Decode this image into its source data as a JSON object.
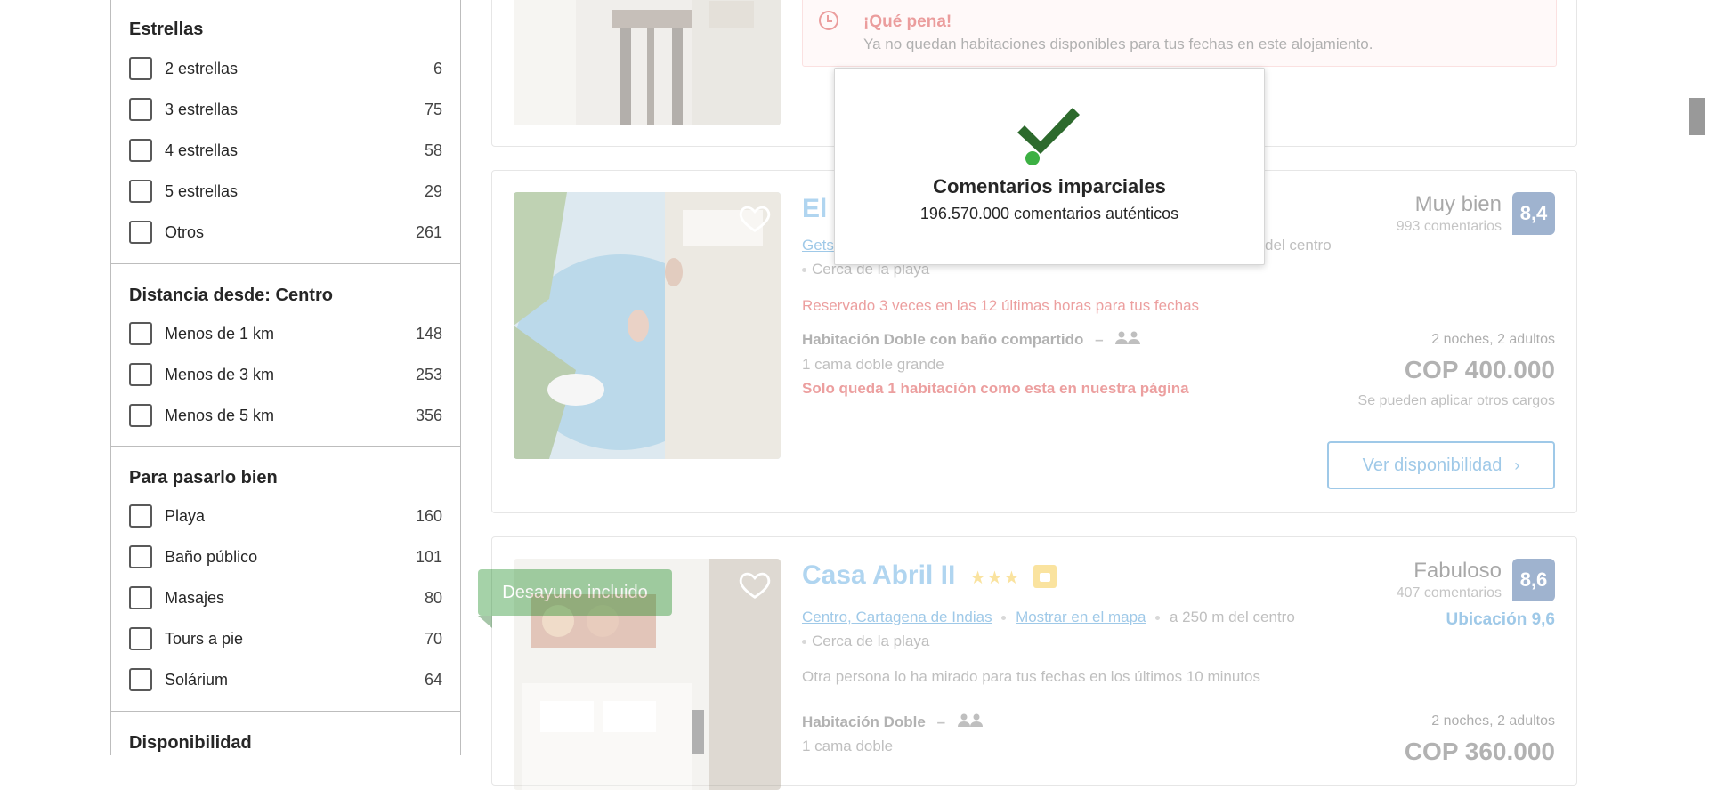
{
  "filters": {
    "estrellas": {
      "title": "Estrellas",
      "items": [
        {
          "label": "2 estrellas",
          "count": "6"
        },
        {
          "label": "3 estrellas",
          "count": "75"
        },
        {
          "label": "4 estrellas",
          "count": "58"
        },
        {
          "label": "5 estrellas",
          "count": "29"
        },
        {
          "label": "Otros",
          "count": "261"
        }
      ]
    },
    "distancia": {
      "title": "Distancia desde: Centro",
      "items": [
        {
          "label": "Menos de 1 km",
          "count": "148"
        },
        {
          "label": "Menos de 3 km",
          "count": "253"
        },
        {
          "label": "Menos de 5 km",
          "count": "356"
        }
      ]
    },
    "pasarlo": {
      "title": "Para pasarlo bien",
      "items": [
        {
          "label": "Playa",
          "count": "160"
        },
        {
          "label": "Baño público",
          "count": "101"
        },
        {
          "label": "Masajes",
          "count": "80"
        },
        {
          "label": "Tours a pie",
          "count": "70"
        },
        {
          "label": "Solárium",
          "count": "64"
        }
      ]
    },
    "disponibilidad": {
      "title": "Disponibilidad"
    }
  },
  "card0": {
    "alert_title": "¡Qué pena!",
    "alert_text": "Ya no quedan habitaciones disponibles para tus fechas en este alojamiento."
  },
  "card1": {
    "name": "El A",
    "location_link": "Gets",
    "location_tail": "del centro",
    "beach": "Cerca de la playa",
    "booked": "Reservado 3 veces en las 12 últimas horas para tus fechas",
    "room": "Habitación Doble con baño compartido",
    "bed": "1 cama doble grande",
    "scarcity": "Solo queda 1 habitación como esta en nuestra página",
    "rating_word": "Muy bien",
    "rating_count": "993 comentarios",
    "score": "8,4",
    "stay": "2 noches, 2 adultos",
    "price": "COP 400.000",
    "fees": "Se pueden aplicar otros cargos",
    "button": "Ver disponibilidad",
    "dash": "–"
  },
  "card2": {
    "ribbon": "Desayuno incluido",
    "name": "Casa Abril II",
    "stars": "★★★",
    "district": "Centro, Cartagena de Indias",
    "map_link": "Mostrar en el mapa",
    "distance": "a 250 m del centro",
    "beach": "Cerca de la playa",
    "looking": "Otra persona lo ha mirado para tus fechas en los últimos 10 minutos",
    "room": "Habitación Doble",
    "bed": "1 cama doble",
    "rating_word": "Fabuloso",
    "rating_count": "407 comentarios",
    "score": "8,6",
    "location_score": "Ubicación 9,6",
    "stay": "2 noches, 2 adultos",
    "price": "COP 360.000",
    "dash": "–"
  },
  "popup": {
    "title": "Comentarios imparciales",
    "subtitle": "196.570.000 comentarios auténticos"
  },
  "colors": {
    "brand_blue": "#0071c2",
    "score_blue": "#003580",
    "alert_red": "#cc0000",
    "green": "#008009",
    "check_green": "#2d6a2d"
  }
}
